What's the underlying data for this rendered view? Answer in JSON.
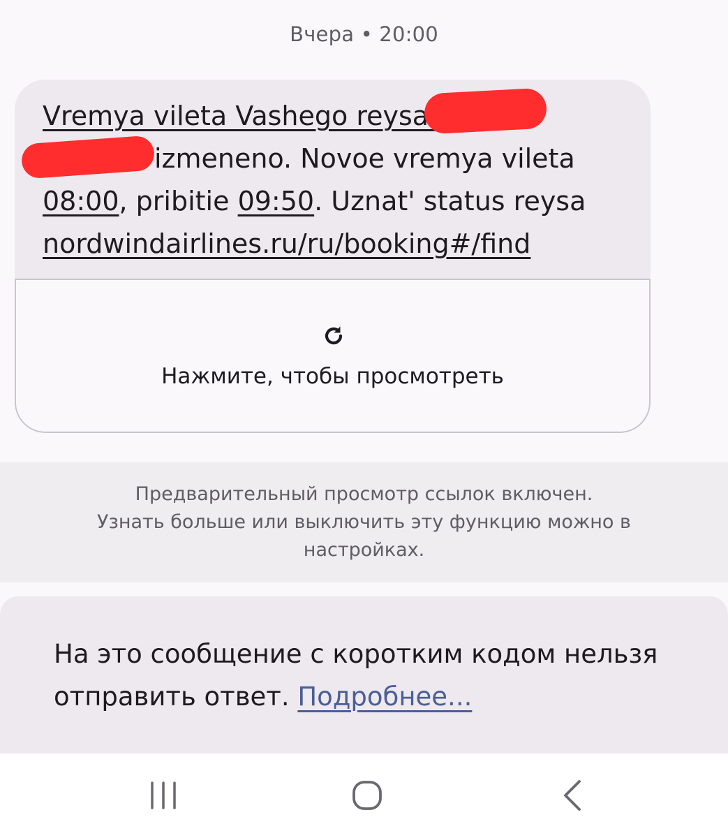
{
  "header": {
    "timestamp": "Вчера • 20:00"
  },
  "message": {
    "line1_text": "Vremya vileta Vashego reysa N",
    "line2_text": "izmeneno. Novoe vremya vileta",
    "departure_time": "08:00",
    "arrival_label": ", pribitie ",
    "arrival_time": "09:50",
    "status_text": ". Uznat' status reysa",
    "url": "nordwindairlines.ru/ru/booking#/find"
  },
  "link_preview": {
    "icon": "refresh-icon",
    "label": "Нажмите, чтобы просмотреть"
  },
  "info": {
    "line1": "Предварительный просмотр ссылок включен.",
    "line2": "Узнать больше или выключить эту функцию можно в",
    "line3": "настройках."
  },
  "reply_notice": {
    "line1": "На это сообщение с коротким кодом нельзя",
    "line2": "отправить ответ. ",
    "more_link": "Подробнее..."
  },
  "nav": {
    "recents_icon": "recents-icon",
    "home_icon": "home-icon",
    "back_icon": "back-icon"
  },
  "colors": {
    "redaction": "#ff2d2d",
    "link_accent": "#4b5e96",
    "bubble_bg": "#ede9ef"
  }
}
